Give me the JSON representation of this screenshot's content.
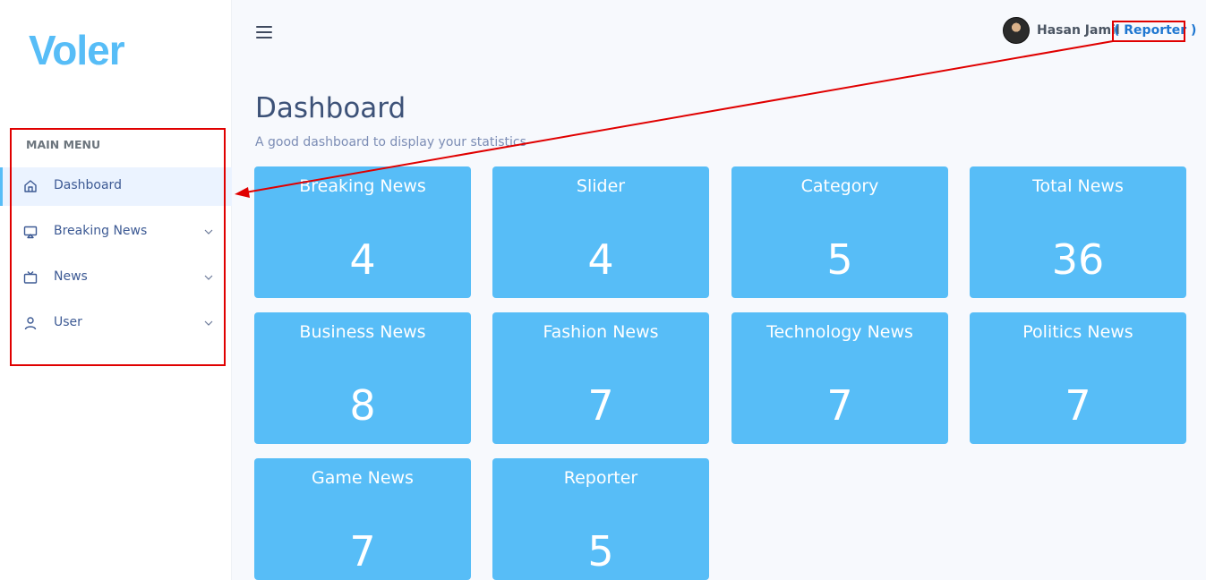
{
  "brand": {
    "logo_text": "Voler",
    "color": "#57bdf7"
  },
  "sidebar": {
    "menu_title": "MAIN MENU",
    "items": [
      {
        "label": "Dashboard",
        "icon": "home-icon",
        "active": true,
        "has_submenu": false
      },
      {
        "label": "Breaking News",
        "icon": "cast-icon",
        "active": false,
        "has_submenu": true
      },
      {
        "label": "News",
        "icon": "tv-icon",
        "active": false,
        "has_submenu": true
      },
      {
        "label": "User",
        "icon": "user-icon",
        "active": false,
        "has_submenu": true
      }
    ]
  },
  "header": {
    "menu_toggle_icon": "hamburger-icon",
    "user_name": "Hasan Jamil",
    "user_role": "( Reporter )"
  },
  "page": {
    "title": "Dashboard",
    "subtitle": "A good dashboard to display your statistics"
  },
  "cards": [
    {
      "title": "Breaking News",
      "value": "4"
    },
    {
      "title": "Slider",
      "value": "4"
    },
    {
      "title": "Category",
      "value": "5"
    },
    {
      "title": "Total News",
      "value": "36"
    },
    {
      "title": "Business News",
      "value": "8"
    },
    {
      "title": "Fashion News",
      "value": "7"
    },
    {
      "title": "Technology News",
      "value": "7"
    },
    {
      "title": "Politics News",
      "value": "7"
    },
    {
      "title": "Game News",
      "value": "7"
    },
    {
      "title": "Reporter",
      "value": "5"
    }
  ],
  "colors": {
    "card_bg": "#57bdf7",
    "annotation": "#e00000",
    "active_bg": "#ebf3ff"
  }
}
